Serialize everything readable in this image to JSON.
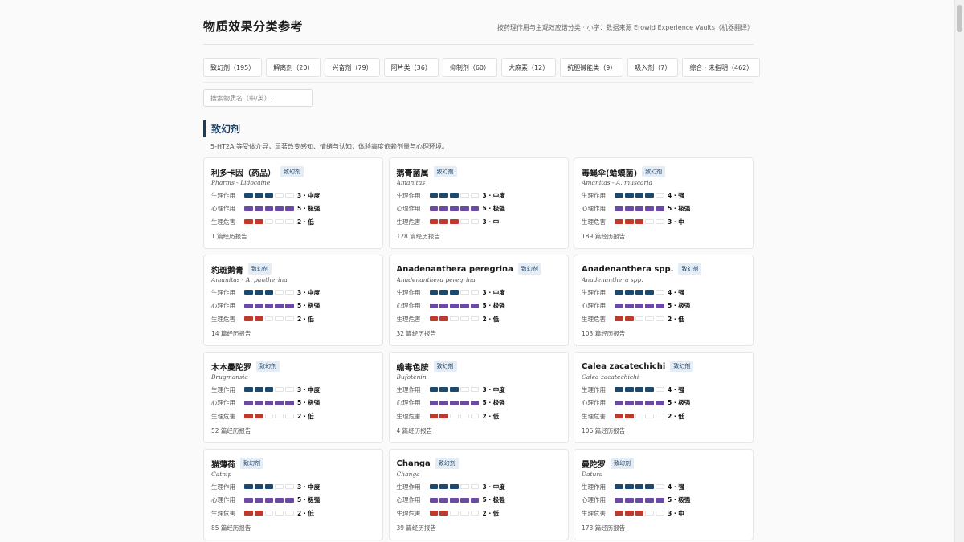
{
  "header": {
    "title": "物质效果分类参考",
    "subtitle": "按药理作用与主观效应谱分类 · 小字：数据来源 Erowid Experience Vaults（机器翻译）"
  },
  "tabs": [
    {
      "label": "致幻剂（195）"
    },
    {
      "label": "解离剂（20）"
    },
    {
      "label": "兴奋剂（79）"
    },
    {
      "label": "阿片类（36）"
    },
    {
      "label": "抑制剂（60）"
    },
    {
      "label": "大麻素（12）"
    },
    {
      "label": "抗胆碱能类（9）"
    },
    {
      "label": "吸入剂（7）"
    },
    {
      "label": "综合 · 未指明（462）"
    }
  ],
  "search": {
    "placeholder": "搜索物质名（中/英）..."
  },
  "section": {
    "title": "致幻剂",
    "description": "5-HT2A 等受体介导，显著改变感知、情绪与认知；体验高度依赖剂量与心理环境。"
  },
  "metric_labels": {
    "physical": "生理作用",
    "mental": "心理作用",
    "harm": "生理危害"
  },
  "colors": {
    "physical": "#1b4a6e",
    "mental": "#6b4aa3",
    "harm": "#c0392b",
    "empty": "#ffffff"
  },
  "cards": [
    {
      "name": "利多卡因（药品）",
      "badge": "致幻剂",
      "latin": "Pharms - Lidocaine",
      "physical": 3,
      "physical_text": "3 · 中度",
      "mental": 5,
      "mental_text": "5 · 极强",
      "harm": 2,
      "harm_text": "2 · 低",
      "reports": "1 篇经历报告"
    },
    {
      "name": "鹅膏菌属",
      "badge": "致幻剂",
      "latin": "Amanitas",
      "physical": 3,
      "physical_text": "3 · 中度",
      "mental": 5,
      "mental_text": "5 · 极强",
      "harm": 3,
      "harm_text": "3 · 中",
      "reports": "128 篇经历报告"
    },
    {
      "name": "毒蝇伞(蛤蟆菌)",
      "badge": "致幻剂",
      "latin": "Amanitas - A. muscaria",
      "physical": 4,
      "physical_text": "4 · 强",
      "mental": 5,
      "mental_text": "5 · 极强",
      "harm": 3,
      "harm_text": "3 · 中",
      "reports": "189 篇经历报告"
    },
    {
      "name": "豹斑鹅膏",
      "badge": "致幻剂",
      "latin": "Amanitas - A. pantherina",
      "physical": 3,
      "physical_text": "3 · 中度",
      "mental": 5,
      "mental_text": "5 · 极强",
      "harm": 2,
      "harm_text": "2 · 低",
      "reports": "14 篇经历报告"
    },
    {
      "name": "Anadenanthera peregrina",
      "badge": "致幻剂",
      "latin": "Anadenanthera peregrina",
      "physical": 3,
      "physical_text": "3 · 中度",
      "mental": 5,
      "mental_text": "5 · 极强",
      "harm": 2,
      "harm_text": "2 · 低",
      "reports": "32 篇经历报告"
    },
    {
      "name": "Anadenanthera spp.",
      "badge": "致幻剂",
      "latin": "Anadenanthera spp.",
      "physical": 4,
      "physical_text": "4 · 强",
      "mental": 5,
      "mental_text": "5 · 极强",
      "harm": 2,
      "harm_text": "2 · 低",
      "reports": "103 篇经历报告"
    },
    {
      "name": "木本曼陀罗",
      "badge": "致幻剂",
      "latin": "Brugmansia",
      "physical": 3,
      "physical_text": "3 · 中度",
      "mental": 5,
      "mental_text": "5 · 极强",
      "harm": 2,
      "harm_text": "2 · 低",
      "reports": "52 篇经历报告"
    },
    {
      "name": "蟾毒色胺",
      "badge": "致幻剂",
      "latin": "Bufotenin",
      "physical": 3,
      "physical_text": "3 · 中度",
      "mental": 5,
      "mental_text": "5 · 极强",
      "harm": 2,
      "harm_text": "2 · 低",
      "reports": "4 篇经历报告"
    },
    {
      "name": "Calea zacatechichi",
      "badge": "致幻剂",
      "latin": "Calea zacatechichi",
      "physical": 4,
      "physical_text": "4 · 强",
      "mental": 5,
      "mental_text": "5 · 极强",
      "harm": 2,
      "harm_text": "2 · 低",
      "reports": "106 篇经历报告"
    },
    {
      "name": "猫薄荷",
      "badge": "致幻剂",
      "latin": "Catnip",
      "physical": 3,
      "physical_text": "3 · 中度",
      "mental": 5,
      "mental_text": "5 · 极强",
      "harm": 2,
      "harm_text": "2 · 低",
      "reports": "85 篇经历报告"
    },
    {
      "name": "Changa",
      "badge": "致幻剂",
      "latin": "Changa",
      "physical": 3,
      "physical_text": "3 · 中度",
      "mental": 5,
      "mental_text": "5 · 极强",
      "harm": 2,
      "harm_text": "2 · 低",
      "reports": "39 篇经历报告"
    },
    {
      "name": "曼陀罗",
      "badge": "致幻剂",
      "latin": "Datura",
      "physical": 4,
      "physical_text": "4 · 强",
      "mental": 5,
      "mental_text": "5 · 极强",
      "harm": 3,
      "harm_text": "3 · 中",
      "reports": "173 篇经历报告"
    }
  ]
}
